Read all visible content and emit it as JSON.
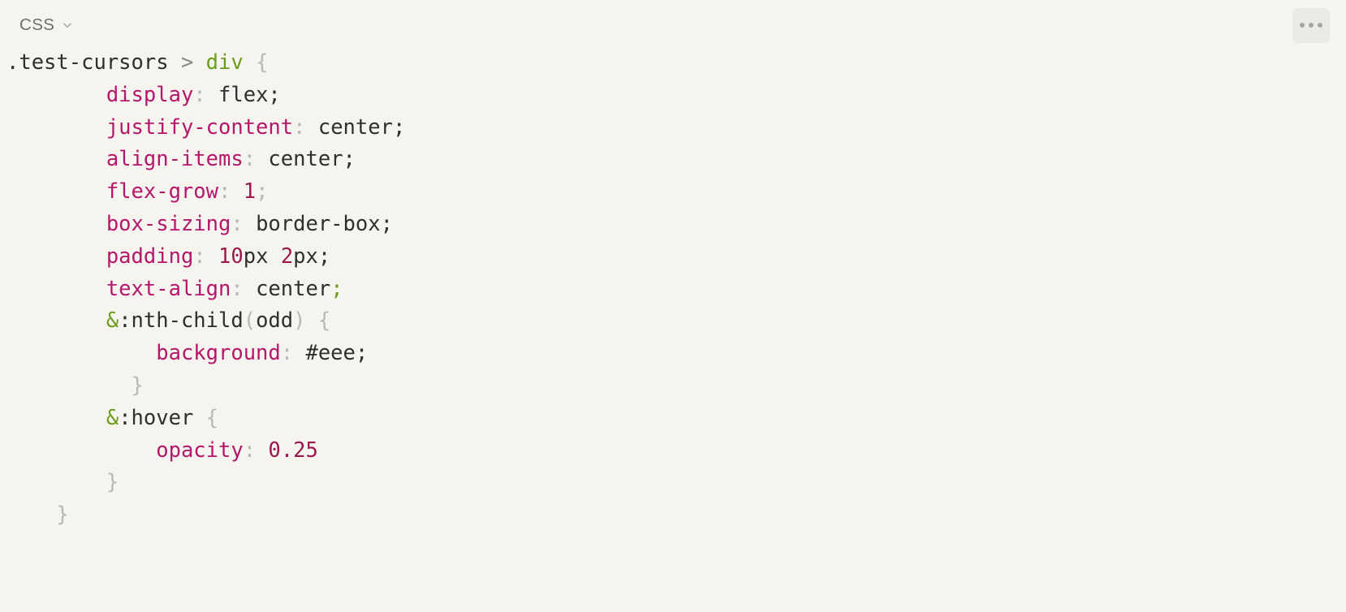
{
  "header": {
    "language_label": "CSS",
    "chevron_icon": "chevron-down-icon",
    "more_button_icon": "ellipsis-horizontal-icon",
    "more_button_title": "More options"
  },
  "colors": {
    "background": "#f5f4ef",
    "button_background": "#ebeae4",
    "text_default": "#2f2f2d",
    "property": "#b5176b",
    "number": "#9c1950",
    "tag_selector": "#6d9c1f",
    "brace": "#b9b8b2",
    "muted": "#8a8a84",
    "header_label": "#6e6e6a"
  },
  "editor": {
    "language": "CSS",
    "code_lines": [
      {
        "indent": 0,
        "tokens": [
          {
            "t": ".test-cursors",
            "c": "tok-sel"
          },
          {
            "t": " ",
            "c": "tok-val"
          },
          {
            "t": ">",
            "c": "tok-combin"
          },
          {
            "t": " ",
            "c": "tok-val"
          },
          {
            "t": "div",
            "c": "tok-tag"
          },
          {
            "t": " ",
            "c": "tok-val"
          },
          {
            "t": "{",
            "c": "tok-brace"
          }
        ]
      },
      {
        "indent": 4,
        "tokens": [
          {
            "t": "display",
            "c": "tok-prop"
          },
          {
            "t": ":",
            "c": "tok-colon"
          },
          {
            "t": " flex",
            "c": "tok-val"
          },
          {
            "t": ";",
            "c": "tok-punc"
          }
        ]
      },
      {
        "indent": 4,
        "tokens": [
          {
            "t": "justify-content",
            "c": "tok-prop"
          },
          {
            "t": ":",
            "c": "tok-colon"
          },
          {
            "t": " center",
            "c": "tok-val"
          },
          {
            "t": ";",
            "c": "tok-punc"
          }
        ]
      },
      {
        "indent": 4,
        "tokens": [
          {
            "t": "align-items",
            "c": "tok-prop"
          },
          {
            "t": ":",
            "c": "tok-colon"
          },
          {
            "t": " center",
            "c": "tok-val"
          },
          {
            "t": ";",
            "c": "tok-punc"
          }
        ]
      },
      {
        "indent": 4,
        "tokens": [
          {
            "t": "flex-grow",
            "c": "tok-prop"
          },
          {
            "t": ":",
            "c": "tok-colon"
          },
          {
            "t": " ",
            "c": "tok-val"
          },
          {
            "t": "1",
            "c": "tok-num"
          },
          {
            "t": ";",
            "c": "tok-colon"
          }
        ]
      },
      {
        "indent": 4,
        "tokens": [
          {
            "t": "box-sizing",
            "c": "tok-prop"
          },
          {
            "t": ":",
            "c": "tok-colon"
          },
          {
            "t": " border-box",
            "c": "tok-val"
          },
          {
            "t": ";",
            "c": "tok-punc"
          }
        ]
      },
      {
        "indent": 4,
        "tokens": [
          {
            "t": "padding",
            "c": "tok-prop"
          },
          {
            "t": ":",
            "c": "tok-colon"
          },
          {
            "t": " ",
            "c": "tok-val"
          },
          {
            "t": "10",
            "c": "tok-num"
          },
          {
            "t": "px",
            "c": "tok-val"
          },
          {
            "t": " ",
            "c": "tok-val"
          },
          {
            "t": "2",
            "c": "tok-num"
          },
          {
            "t": "px",
            "c": "tok-val"
          },
          {
            "t": ";",
            "c": "tok-punc"
          }
        ]
      },
      {
        "indent": 4,
        "tokens": [
          {
            "t": "text-align",
            "c": "tok-prop"
          },
          {
            "t": ":",
            "c": "tok-colon"
          },
          {
            "t": " center",
            "c": "tok-val"
          },
          {
            "t": ";",
            "c": "tok-semi-g"
          }
        ]
      },
      {
        "indent": 4,
        "tokens": [
          {
            "t": "&",
            "c": "tok-tag"
          },
          {
            "t": ":nth-child",
            "c": "tok-pseudo"
          },
          {
            "t": "(",
            "c": "tok-paren"
          },
          {
            "t": "odd",
            "c": "tok-val"
          },
          {
            "t": ")",
            "c": "tok-paren"
          },
          {
            "t": " ",
            "c": "tok-val"
          },
          {
            "t": "{",
            "c": "tok-brace"
          }
        ]
      },
      {
        "indent": 6,
        "tokens": [
          {
            "t": "background",
            "c": "tok-prop"
          },
          {
            "t": ":",
            "c": "tok-colon"
          },
          {
            "t": " #eee",
            "c": "tok-val"
          },
          {
            "t": ";",
            "c": "tok-punc"
          }
        ]
      },
      {
        "indent": 5,
        "tokens": [
          {
            "t": "}",
            "c": "tok-brace"
          }
        ]
      },
      {
        "indent": 4,
        "tokens": [
          {
            "t": "&",
            "c": "tok-tag"
          },
          {
            "t": ":hover",
            "c": "tok-pseudo"
          },
          {
            "t": " ",
            "c": "tok-val"
          },
          {
            "t": "{",
            "c": "tok-brace"
          }
        ]
      },
      {
        "indent": 6,
        "tokens": [
          {
            "t": "opacity",
            "c": "tok-prop"
          },
          {
            "t": ":",
            "c": "tok-colon"
          },
          {
            "t": " ",
            "c": "tok-val"
          },
          {
            "t": "0.25",
            "c": "tok-num"
          }
        ]
      },
      {
        "indent": 4,
        "tokens": [
          {
            "t": "}",
            "c": "tok-brace"
          }
        ]
      },
      {
        "indent": 2,
        "tokens": [
          {
            "t": "}",
            "c": "tok-brace"
          }
        ]
      }
    ],
    "plain_text": ".test-cursors > div {\n    display: flex;\n    justify-content: center;\n    align-items: center;\n    flex-grow: 1;\n    box-sizing: border-box;\n    padding: 10px 2px;\n    text-align: center;\n    &:nth-child(odd) {\n      background: #eee;\n     }\n    &:hover {\n      opacity: 0.25\n    }\n  }"
  }
}
